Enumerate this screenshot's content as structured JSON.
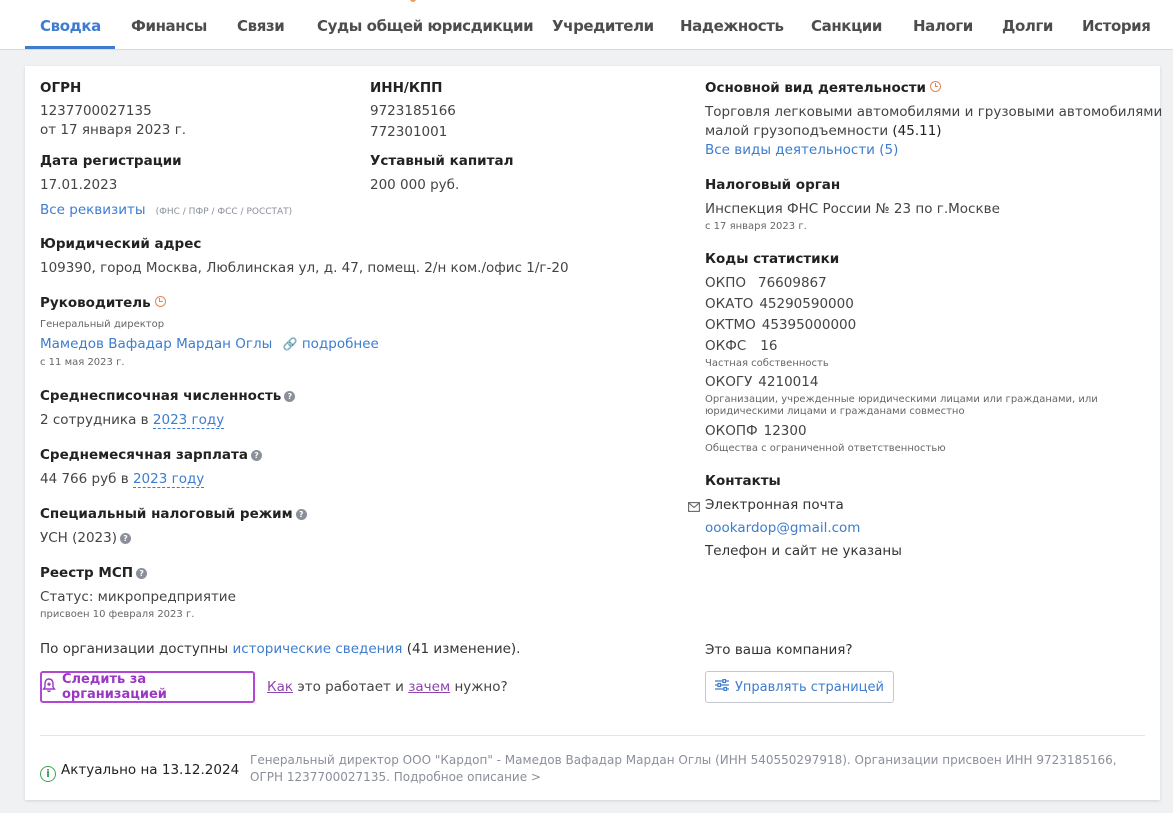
{
  "tabs": [
    "Сводка",
    "Финансы",
    "Связи",
    "Суды общей юрисдикции",
    "Учредители",
    "Надежность",
    "Санкции",
    "Налоги",
    "Долги",
    "История"
  ],
  "ogrn": {
    "label": "ОГРН",
    "value": "1237700027135",
    "date": "от 17 января 2023 г."
  },
  "inn": {
    "label": "ИНН/КПП",
    "inn": "9723185166",
    "kpp": "772301001"
  },
  "reg": {
    "label": "Дата регистрации",
    "value": "17.01.2023"
  },
  "capital": {
    "label": "Уставный капитал",
    "value": "200 000 руб."
  },
  "requisites": {
    "link": "Все реквизиты",
    "note": "(ФНС / ПФР / ФСС / РОССТАТ)"
  },
  "address": {
    "label": "Юридический адрес",
    "value": "109390, город Москва, Люблинская ул, д. 47, помещ. 2/н ком./офис 1/г-20"
  },
  "director": {
    "label": "Руководитель",
    "role": "Генеральный директор",
    "name": "Мамедов Вафадар Мардан Оглы",
    "more": "подробнее",
    "since": "с 11 мая 2023 г."
  },
  "headcount": {
    "label": "Среднесписочная численность",
    "value": "2 сотрудника в",
    "year": "2023 году"
  },
  "salary": {
    "label": "Среднемесячная зарплата",
    "value": "44 766 руб в",
    "year": "2023 году"
  },
  "tax_regime": {
    "label": "Специальный налоговый режим",
    "value": "УСН (2023)"
  },
  "msp": {
    "label": "Реестр МСП",
    "status": "Статус: микропредприятие",
    "since": "присвоен 10 февраля 2023 г."
  },
  "history": {
    "prefix": "По организации доступны",
    "link": "исторические сведения",
    "suffix": "(41 изменение)."
  },
  "follow": {
    "button": "Следить за организацией",
    "how": "Как",
    "works": "это работает и",
    "why": "зачем",
    "need": "нужно?"
  },
  "activity": {
    "label": "Основной вид деятельности",
    "line1": "Торговля легковыми автомобилями и грузовыми автомобилями",
    "line2": "малой грузоподъемности",
    "code": "(45.11)",
    "all": "Все виды деятельности (5)"
  },
  "tax_org": {
    "label": "Налоговый орган",
    "value": "Инспекция ФНС России № 23 по г.Москве",
    "since": "с 17 января 2023 г."
  },
  "stats": {
    "label": "Коды статистики",
    "okpo": {
      "name": "ОКПО",
      "value": "76609867"
    },
    "okato": {
      "name": "ОКАТО",
      "value": "45290590000"
    },
    "oktmo": {
      "name": "ОКТМО",
      "value": "45395000000"
    },
    "okfs": {
      "name": "ОКФС",
      "value": "16",
      "desc": "Частная собственность"
    },
    "okogu": {
      "name": "ОКОГУ",
      "value": "4210014",
      "desc1": "Организации, учрежденные юридическими лицами или гражданами, или",
      "desc2": "юридическими лицами и гражданами совместно"
    },
    "okopf": {
      "name": "ОКОПФ",
      "value": "12300",
      "desc": "Общества с ограниченной ответственностью"
    }
  },
  "contacts": {
    "label": "Контакты",
    "email_label": "Электронная почта",
    "email": "oookardop@gmail.com",
    "phone": "Телефон и сайт не указаны"
  },
  "company": {
    "question": "Это ваша компания?",
    "manage": "Управлять страницей"
  },
  "footer": {
    "actual": "Актуально на 13.12.2024",
    "desc": "Генеральный директор ООО \"Кардоп\" - Мамедов Вафадар Мардан Оглы (ИНН 540550297918). Организации присвоен ИНН 9723185166, ОГРН 1237700027135. Подробное описание >"
  }
}
